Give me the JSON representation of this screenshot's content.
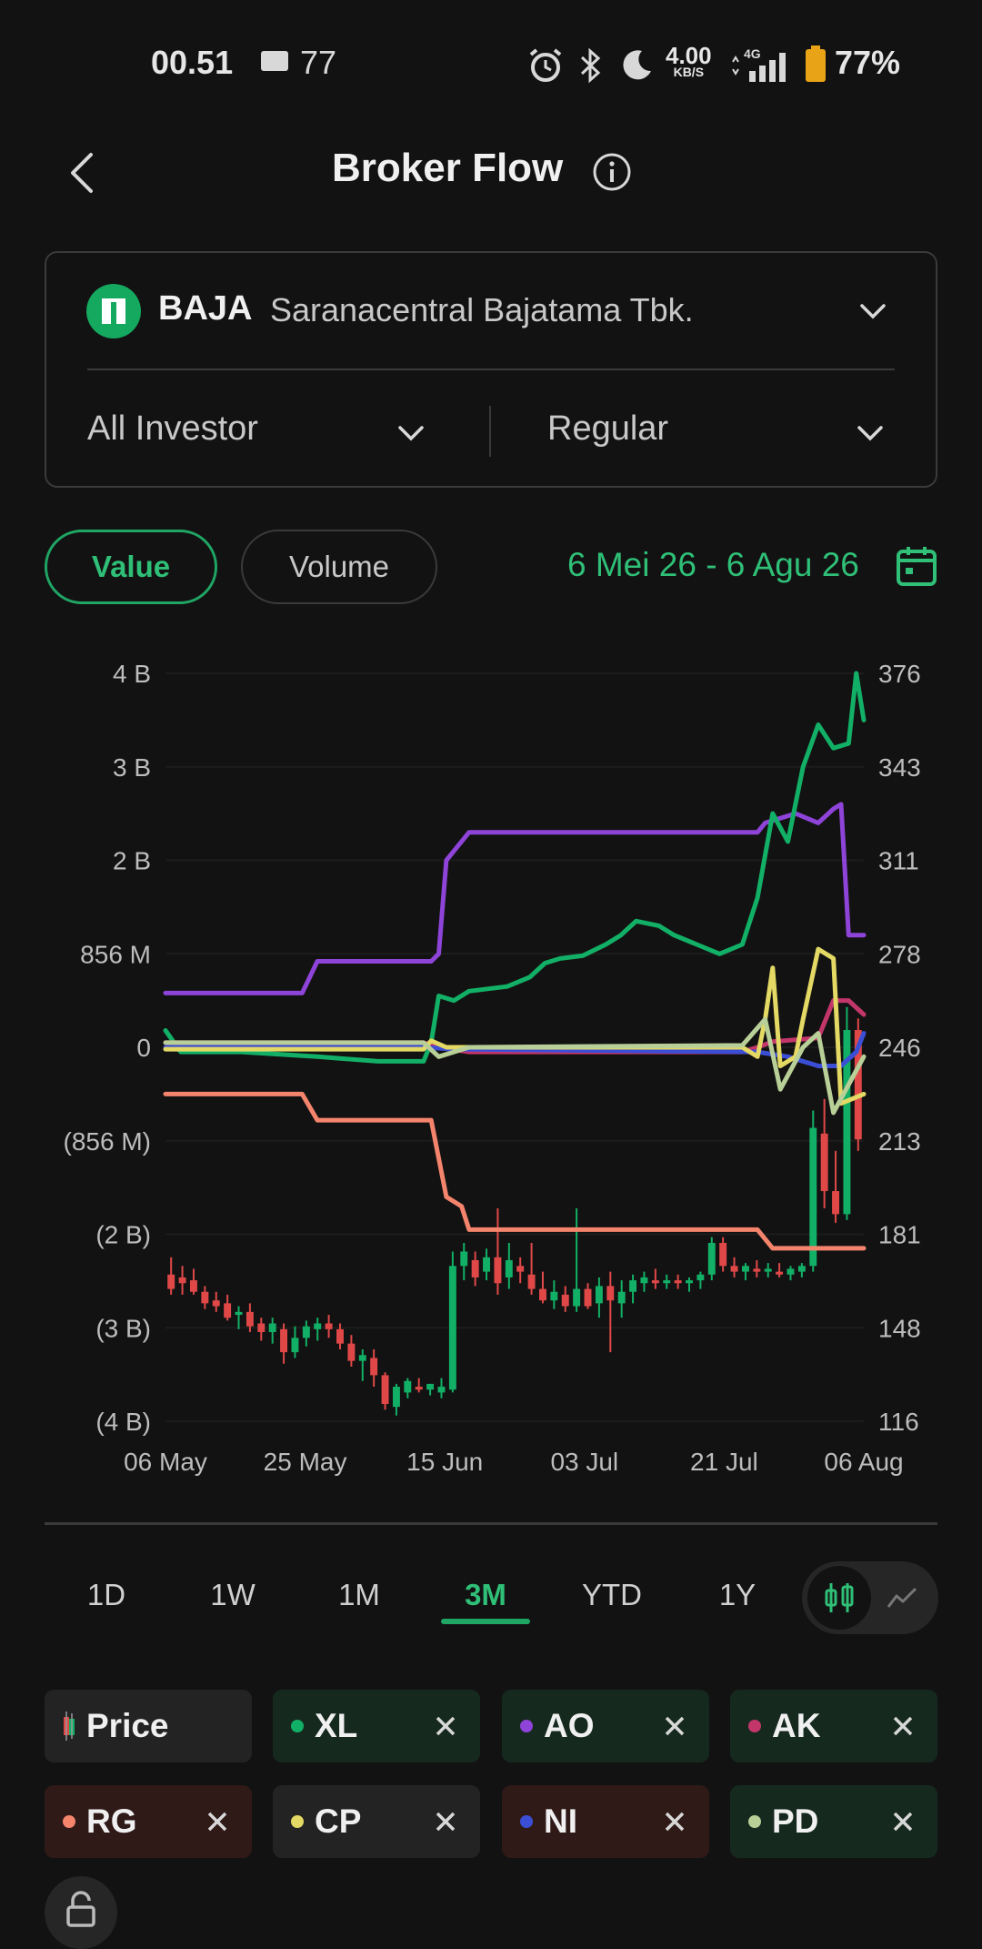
{
  "status_bar": {
    "time": "00.51",
    "notification_count": "77",
    "speed_value": "4.00",
    "speed_unit": "KB/S",
    "network": "4G",
    "battery": "77%"
  },
  "header": {
    "title": "Broker Flow"
  },
  "stock": {
    "ticker": "BAJA",
    "name": "Saranacentral Bajatama Tbk.",
    "investor_filter": "All Investor",
    "market_filter": "Regular"
  },
  "toggle": {
    "value_label": "Value",
    "volume_label": "Volume"
  },
  "date_range": "6 Mei 26 - 6 Agu 26",
  "range_tabs": [
    "1D",
    "1W",
    "1M",
    "3M",
    "YTD",
    "1Y"
  ],
  "selected_range": "3M",
  "colors": {
    "accent": "#1fa564",
    "XL": "#12b066",
    "AO": "#8e44d8",
    "AK": "#c2366a",
    "RG": "#f4846c",
    "CP": "#e3d964",
    "NI": "#3b4fd6",
    "PD": "#b9cf98",
    "candle_up": "#12b066",
    "candle_down": "#e04848"
  },
  "legend": [
    {
      "label": "Price",
      "color": "#12b066",
      "removable": false
    },
    {
      "label": "XL",
      "color": "#12b066",
      "removable": true
    },
    {
      "label": "AO",
      "color": "#8e44d8",
      "removable": true
    },
    {
      "label": "AK",
      "color": "#c2366a",
      "removable": true
    },
    {
      "label": "RG",
      "color": "#f4846c",
      "removable": true
    },
    {
      "label": "CP",
      "color": "#e3d964",
      "removable": true
    },
    {
      "label": "NI",
      "color": "#3b4fd6",
      "removable": true
    },
    {
      "label": "PD",
      "color": "#b9cf98",
      "removable": true
    }
  ],
  "chart_data": {
    "type": "line",
    "grid": true,
    "left_axis": {
      "tick_labels": [
        "4 B",
        "3 B",
        "2 B",
        "856 M",
        "0",
        "(856 M)",
        "(2 B)",
        "(3 B)",
        "(4 B)"
      ],
      "range": [
        -4,
        4
      ],
      "unit": "B"
    },
    "right_axis": {
      "tick_labels": [
        "376",
        "343",
        "311",
        "278",
        "246",
        "213",
        "181",
        "148",
        "116"
      ],
      "range": [
        116,
        376
      ]
    },
    "x_tick_labels": [
      "06 May",
      "25 May",
      "15 Jun",
      "03 Jul",
      "21 Jul",
      "06 Aug"
    ],
    "x_range_days": [
      0,
      92
    ],
    "series": [
      {
        "name": "AO",
        "color": "#8e44d8",
        "points": [
          [
            0,
            0.58
          ],
          [
            18,
            0.58
          ],
          [
            20,
            0.92
          ],
          [
            35,
            0.92
          ],
          [
            36,
            1.0
          ],
          [
            37,
            2.0
          ],
          [
            39,
            2.2
          ],
          [
            40,
            2.3
          ],
          [
            78,
            2.3
          ],
          [
            79,
            2.4
          ],
          [
            83,
            2.5
          ],
          [
            86,
            2.4
          ],
          [
            88,
            2.55
          ],
          [
            89,
            2.6
          ],
          [
            90,
            1.2
          ],
          [
            92,
            1.2
          ]
        ]
      },
      {
        "name": "XL",
        "color": "#12b066",
        "points": [
          [
            0,
            0.18
          ],
          [
            2,
            -0.05
          ],
          [
            10,
            -0.05
          ],
          [
            20,
            -0.1
          ],
          [
            28,
            -0.15
          ],
          [
            34,
            -0.15
          ],
          [
            35,
            0.05
          ],
          [
            36,
            0.55
          ],
          [
            38,
            0.5
          ],
          [
            40,
            0.6
          ],
          [
            45,
            0.65
          ],
          [
            48,
            0.75
          ],
          [
            50,
            0.9
          ],
          [
            52,
            0.95
          ],
          [
            55,
            0.98
          ],
          [
            58,
            1.1
          ],
          [
            60,
            1.2
          ],
          [
            62,
            1.35
          ],
          [
            65,
            1.3
          ],
          [
            67,
            1.2
          ],
          [
            70,
            1.1
          ],
          [
            73,
            1.0
          ],
          [
            76,
            1.1
          ],
          [
            78,
            1.6
          ],
          [
            80,
            2.5
          ],
          [
            82,
            2.2
          ],
          [
            84,
            3.0
          ],
          [
            86,
            3.45
          ],
          [
            88,
            3.2
          ],
          [
            90,
            3.25
          ],
          [
            91,
            4.0
          ],
          [
            92,
            3.5
          ]
        ]
      },
      {
        "name": "RG",
        "color": "#f4846c",
        "points": [
          [
            0,
            -0.5
          ],
          [
            18,
            -0.5
          ],
          [
            20,
            -0.78
          ],
          [
            35,
            -0.78
          ],
          [
            37,
            -1.6
          ],
          [
            39,
            -1.7
          ],
          [
            40,
            -1.95
          ],
          [
            78,
            -1.95
          ],
          [
            80,
            -2.15
          ],
          [
            92,
            -2.15
          ]
        ]
      },
      {
        "name": "AK",
        "color": "#c2366a",
        "points": [
          [
            0,
            0.05
          ],
          [
            34,
            0.05
          ],
          [
            36,
            0.0
          ],
          [
            40,
            -0.05
          ],
          [
            76,
            -0.05
          ],
          [
            78,
            0.0
          ],
          [
            80,
            0.06
          ],
          [
            86,
            0.1
          ],
          [
            88,
            0.5
          ],
          [
            90,
            0.5
          ],
          [
            92,
            0.35
          ]
        ]
      },
      {
        "name": "NI",
        "color": "#3b4fd6",
        "points": [
          [
            0,
            0.0
          ],
          [
            34,
            0.0
          ],
          [
            38,
            -0.02
          ],
          [
            78,
            -0.05
          ],
          [
            82,
            -0.1
          ],
          [
            86,
            -0.2
          ],
          [
            89,
            -0.2
          ],
          [
            91,
            -0.05
          ],
          [
            92,
            0.15
          ]
        ]
      },
      {
        "name": "CP",
        "color": "#e3d964",
        "points": [
          [
            0,
            -0.02
          ],
          [
            34,
            -0.02
          ],
          [
            35,
            0.07
          ],
          [
            37,
            0.0
          ],
          [
            40,
            0.0
          ],
          [
            76,
            0.0
          ],
          [
            78,
            -0.1
          ],
          [
            79,
            0.3
          ],
          [
            80,
            0.85
          ],
          [
            81,
            -0.2
          ],
          [
            83,
            -0.1
          ],
          [
            84,
            0.3
          ],
          [
            86,
            1.05
          ],
          [
            88,
            0.95
          ],
          [
            89,
            -0.6
          ],
          [
            92,
            -0.5
          ]
        ]
      },
      {
        "name": "PD",
        "color": "#b9cf98",
        "points": [
          [
            0,
            0.05
          ],
          [
            34,
            0.05
          ],
          [
            36,
            -0.1
          ],
          [
            40,
            0.0
          ],
          [
            76,
            0.02
          ],
          [
            79,
            0.3
          ],
          [
            81,
            -0.45
          ],
          [
            84,
            0.0
          ],
          [
            86,
            0.15
          ],
          [
            88,
            -0.7
          ],
          [
            90,
            -0.4
          ],
          [
            92,
            -0.1
          ]
        ]
      }
    ],
    "candles": [
      [
        0,
        167,
        173,
        160,
        162
      ],
      [
        1,
        166,
        170,
        160,
        164
      ],
      [
        2,
        165,
        169,
        160,
        161
      ],
      [
        3,
        161,
        163,
        155,
        157
      ],
      [
        4,
        158,
        161,
        154,
        156
      ],
      [
        5,
        157,
        160,
        151,
        152
      ],
      [
        6,
        153,
        156,
        148,
        154
      ],
      [
        7,
        154,
        157,
        147,
        149
      ],
      [
        8,
        150,
        152,
        144,
        147
      ],
      [
        9,
        147,
        152,
        143,
        150
      ],
      [
        10,
        148,
        150,
        136,
        140
      ],
      [
        11,
        140,
        149,
        138,
        145
      ],
      [
        12,
        145,
        151,
        142,
        149
      ],
      [
        13,
        148,
        152,
        144,
        150
      ],
      [
        14,
        150,
        153,
        145,
        148
      ],
      [
        15,
        148,
        150,
        141,
        143
      ],
      [
        16,
        143,
        146,
        135,
        137
      ],
      [
        17,
        137,
        141,
        130,
        139
      ],
      [
        18,
        138,
        141,
        128,
        132
      ],
      [
        19,
        132,
        133,
        120,
        122
      ],
      [
        20,
        121,
        129,
        118,
        128
      ],
      [
        21,
        126,
        131,
        124,
        130
      ],
      [
        22,
        128,
        131,
        126,
        127
      ],
      [
        23,
        127,
        129,
        125,
        129
      ],
      [
        24,
        126,
        131,
        124,
        128
      ],
      [
        25,
        127,
        175,
        126,
        170
      ],
      [
        26,
        170,
        178,
        165,
        175
      ],
      [
        27,
        172,
        175,
        163,
        166
      ],
      [
        28,
        168,
        176,
        165,
        173
      ],
      [
        29,
        173,
        190,
        160,
        164
      ],
      [
        30,
        166,
        178,
        162,
        172
      ],
      [
        31,
        170,
        173,
        164,
        168
      ],
      [
        32,
        167,
        178,
        160,
        162
      ],
      [
        33,
        162,
        168,
        157,
        158
      ],
      [
        34,
        158,
        165,
        155,
        161
      ],
      [
        35,
        160,
        163,
        154,
        156
      ],
      [
        36,
        156,
        190,
        154,
        162
      ],
      [
        37,
        162,
        164,
        155,
        156
      ],
      [
        38,
        157,
        166,
        152,
        163
      ],
      [
        39,
        163,
        168,
        140,
        158
      ],
      [
        40,
        157,
        165,
        152,
        161
      ],
      [
        41,
        161,
        167,
        157,
        165
      ],
      [
        42,
        164,
        168,
        161,
        166
      ],
      [
        43,
        165,
        169,
        162,
        164
      ],
      [
        44,
        164,
        167,
        162,
        165
      ],
      [
        45,
        165,
        167,
        162,
        164
      ],
      [
        46,
        164,
        166,
        161,
        165
      ],
      [
        47,
        165,
        168,
        162,
        167
      ],
      [
        48,
        167,
        180,
        165,
        178
      ],
      [
        49,
        178,
        180,
        168,
        170
      ],
      [
        50,
        170,
        173,
        166,
        168
      ],
      [
        51,
        168,
        171,
        165,
        170
      ],
      [
        52,
        169,
        172,
        166,
        168
      ],
      [
        53,
        168,
        171,
        166,
        169
      ],
      [
        54,
        168,
        171,
        166,
        167
      ],
      [
        55,
        167,
        170,
        165,
        169
      ],
      [
        56,
        168,
        171,
        166,
        170
      ],
      [
        57,
        170,
        224,
        168,
        218
      ],
      [
        58,
        216,
        228,
        190,
        196
      ],
      [
        59,
        196,
        210,
        185,
        188
      ],
      [
        60,
        188,
        260,
        186,
        252
      ],
      [
        61,
        252,
        256,
        210,
        214
      ]
    ]
  }
}
